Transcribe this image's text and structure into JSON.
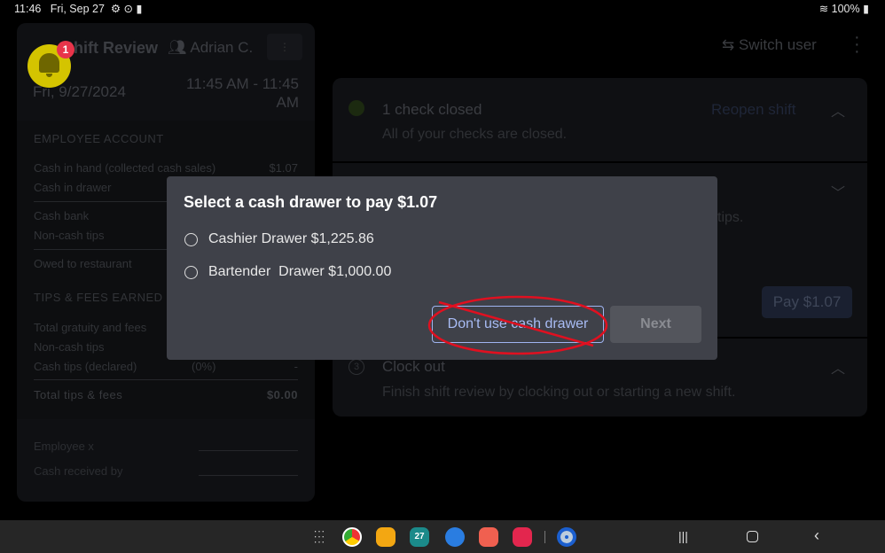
{
  "status_bar": {
    "time": "11:46",
    "date": "Fri, Sep 27",
    "battery": "100%"
  },
  "header": {
    "switch_user": "Switch user"
  },
  "notification": {
    "count": "1"
  },
  "shift_panel": {
    "title": "Shift Review",
    "employee": "Adrian C.",
    "date": "Fri, 9/27/2024",
    "time_range": "11:45 AM - 11:45 AM",
    "employee_account": {
      "heading": "EMPLOYEE ACCOUNT",
      "rows": [
        {
          "label": "Cash in hand (collected cash sales)",
          "value": "$1.07"
        },
        {
          "label": "Cash in drawer",
          "value": ""
        },
        {
          "label": "Cash bank",
          "value": ""
        },
        {
          "label": "Non-cash tips",
          "value": ""
        },
        {
          "label": "Owed to restaurant",
          "value": ""
        }
      ]
    },
    "tips_fees": {
      "heading": "TIPS & FEES EARNED",
      "rows": [
        {
          "label": "Total gratuity and fees",
          "pct": "",
          "value": ""
        },
        {
          "label": "Non-cash tips",
          "pct": "",
          "value": ""
        },
        {
          "label": "Cash tips (declared)",
          "pct": "(0%)",
          "value": "-"
        }
      ],
      "total_label": "Total tips & fees",
      "total_value": "$0.00"
    },
    "signatures": {
      "employee": "Employee x",
      "cash_received": "Cash received by"
    }
  },
  "steps": [
    {
      "title": "1 check closed",
      "desc": "All of your checks are closed.",
      "action": "Reopen shift"
    },
    {
      "desc_tail": "tips.",
      "action": "Pay $1.07"
    },
    {
      "number": "3",
      "title": "Clock out",
      "desc": "Finish shift review by clocking out or starting a new shift."
    }
  ],
  "dialog": {
    "title": "Select a cash drawer to pay $1.07",
    "options": [
      {
        "label": "Cashier Drawer $1,225.86"
      },
      {
        "label": "Bartender  Drawer $1,000.00"
      }
    ],
    "dont_use": "Don't use cash drawer",
    "next": "Next"
  },
  "taskbar": {
    "calendar_day": "27"
  },
  "colors": {
    "accent": "#9fb4f0",
    "annotation": "#e01020",
    "badge": "#e8344a",
    "bell": "#d4c400"
  }
}
